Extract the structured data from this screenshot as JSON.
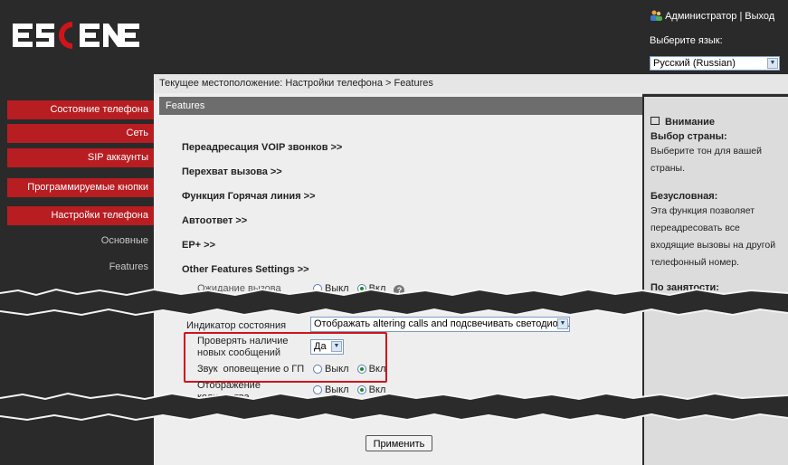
{
  "header": {
    "logo_text": "ESCENE",
    "user": "Администратор",
    "logout": "Выход",
    "separator": "|",
    "lang_label": "Выберите язык:",
    "lang_value": "Русский (Russian)"
  },
  "breadcrumb": "Текущее местоположение: Настройки телефона > Features",
  "sidebar": {
    "items": [
      {
        "label": "Состояние телефона"
      },
      {
        "label": "Сеть"
      },
      {
        "label": "SIP аккаунты"
      },
      {
        "label": "Программируемые кнопки"
      },
      {
        "label": "Настройки телефона"
      }
    ],
    "sub_items": [
      {
        "label": "Основные"
      },
      {
        "label": "Features"
      }
    ]
  },
  "main": {
    "section_title": "Features",
    "links": [
      {
        "label": "Переадресация VOIP звонков   >>"
      },
      {
        "label": "Перехват вызова   >>"
      },
      {
        "label": "Функция Горячая линия   >>"
      },
      {
        "label": "Автоответ   >>"
      },
      {
        "label": "EP+   >>"
      },
      {
        "label": "Other Features Settings   >>"
      }
    ],
    "call_waiting": {
      "label": "Ожидание вызова",
      "off": "Выкл",
      "on": "Вкл"
    },
    "status_indicator": {
      "label": "Индикатор состояния",
      "value": "Отображать altering calls and подсвечивать светодиодами"
    },
    "check_messages": {
      "label": "Проверять наличие новых сообщений",
      "value": "Да"
    },
    "vm_sound": {
      "label": "Звук  оповещение о ГП",
      "off": "Выкл",
      "on": "Вкл"
    },
    "missed_count": {
      "label": "Отображение количества пропущенных вызовов",
      "off": "Выкл",
      "on": "Вкл"
    },
    "apply_label": "Применить"
  },
  "right_panel": {
    "attention_title": "Внимание",
    "country_title": "Выбор страны:",
    "country_text": "Выберите тон для вашей страны.",
    "unconditional_title": "Безусловная:",
    "unconditional_text": "Эта функция позволяет переадресовать все входящие вызовы на другой телефонный номер.",
    "busy_title": "По занятости:"
  },
  "colors": {
    "accent": "#b81d22",
    "highlight": "#d0141b",
    "background_dark": "#2a2a2a",
    "content_bg": "#eeeeee",
    "section_header": "#6d6d6d"
  }
}
